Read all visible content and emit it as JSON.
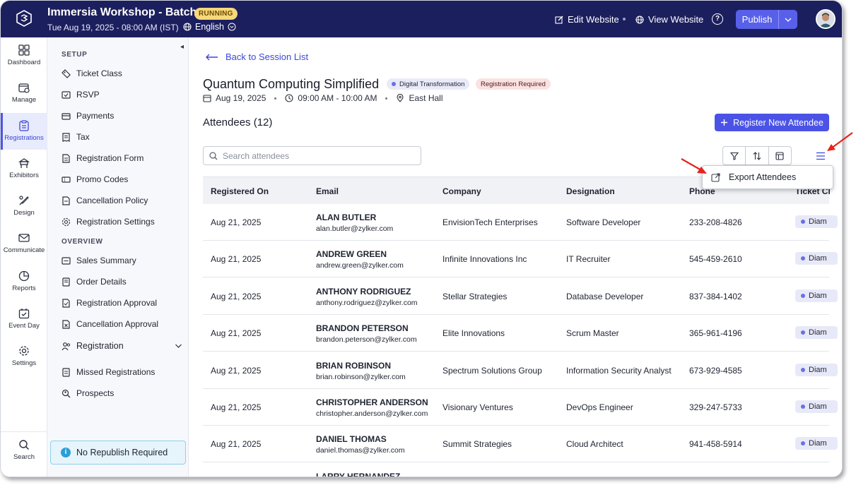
{
  "header": {
    "title": "Immersia Workshop - Batch 7",
    "status_badge": "RUNNING",
    "date": "Tue Aug 19, 2025 - 08:00 AM (IST)",
    "language": "English",
    "edit_website": "Edit Website",
    "view_website": "View Website",
    "help": "?",
    "publish": "Publish"
  },
  "rail": {
    "items": [
      {
        "label": "Dashboard",
        "icon": "dashboard-icon"
      },
      {
        "label": "Manage",
        "icon": "manage-icon"
      },
      {
        "label": "Registrations",
        "icon": "registrations-icon",
        "active": true
      },
      {
        "label": "Exhibitors",
        "icon": "exhibitors-icon"
      },
      {
        "label": "Design",
        "icon": "design-icon"
      },
      {
        "label": "Communicate",
        "icon": "communicate-icon"
      },
      {
        "label": "Reports",
        "icon": "reports-icon"
      },
      {
        "label": "Event Day",
        "icon": "event-day-icon"
      },
      {
        "label": "Settings",
        "icon": "settings-icon"
      }
    ],
    "search": "Search"
  },
  "subnav": {
    "setup_heading": "SETUP",
    "setup_items": [
      "Ticket Class",
      "RSVP",
      "Payments",
      "Tax",
      "Registration Form",
      "Promo Codes",
      "Cancellation Policy",
      "Registration Settings"
    ],
    "overview_heading": "OVERVIEW",
    "overview_items": [
      "Sales Summary",
      "Order Details",
      "Registration Approval",
      "Cancellation Approval",
      "Registration",
      "Missed Registrations",
      "Prospects"
    ],
    "republish": "No Republish Required"
  },
  "main": {
    "back": "Back to Session List",
    "session_title": "Quantum Computing Simplified",
    "tag_1": "Digital Transformation",
    "tag_2": "Registration Required",
    "date": "Aug 19, 2025",
    "time": "09:00 AM - 10:00 AM",
    "venue": "East Hall",
    "attendees_heading": "Attendees (12)",
    "register_button": "Register New Attendee",
    "search_placeholder": "Search attendees",
    "export_menu_item": "Export Attendees"
  },
  "table": {
    "columns": [
      "Registered On",
      "Email",
      "Company",
      "Designation",
      "Phone",
      "Ticket Cl"
    ],
    "rows": [
      {
        "registered_on": "Aug 21, 2025",
        "name": "ALAN BUTLER",
        "email": "alan.butler@zylker.com",
        "company": "EnvisionTech Enterprises",
        "designation": "Software Developer",
        "phone": "233-208-4826",
        "ticket": "Diam"
      },
      {
        "registered_on": "Aug 21, 2025",
        "name": "ANDREW GREEN",
        "email": "andrew.green@zylker.com",
        "company": "Infinite Innovations Inc",
        "designation": "IT Recruiter",
        "phone": "545-459-2610",
        "ticket": "Diam"
      },
      {
        "registered_on": "Aug 21, 2025",
        "name": "ANTHONY RODRIGUEZ",
        "email": "anthony.rodriguez@zylker.com",
        "company": "Stellar Strategies",
        "designation": "Database Developer",
        "phone": "837-384-1402",
        "ticket": "Diam"
      },
      {
        "registered_on": "Aug 21, 2025",
        "name": "BRANDON PETERSON",
        "email": "brandon.peterson@zylker.com",
        "company": "Elite Innovations",
        "designation": "Scrum Master",
        "phone": "365-961-4196",
        "ticket": "Diam"
      },
      {
        "registered_on": "Aug 21, 2025",
        "name": "BRIAN ROBINSON",
        "email": "brian.robinson@zylker.com",
        "company": "Spectrum Solutions Group",
        "designation": "Information Security Analyst",
        "phone": "673-929-4585",
        "ticket": "Diam"
      },
      {
        "registered_on": "Aug 21, 2025",
        "name": "CHRISTOPHER ANDERSON",
        "email": "christopher.anderson@zylker.com",
        "company": "Visionary Ventures",
        "designation": "DevOps Engineer",
        "phone": "329-247-5733",
        "ticket": "Diam"
      },
      {
        "registered_on": "Aug 21, 2025",
        "name": "DANIEL THOMAS",
        "email": "daniel.thomas@zylker.com",
        "company": "Summit Strategies",
        "designation": "Cloud Architect",
        "phone": "941-458-5914",
        "ticket": "Diam"
      },
      {
        "registered_on": "",
        "name": "LARRY HERNANDEZ",
        "email": "",
        "company": "",
        "designation": "",
        "phone": "",
        "ticket": ""
      }
    ]
  },
  "colors": {
    "topbar": "#1c1f5e",
    "accent": "#4b53e6",
    "running_badge": "#f6d77a",
    "annotation_arrow": "#e8221b"
  }
}
